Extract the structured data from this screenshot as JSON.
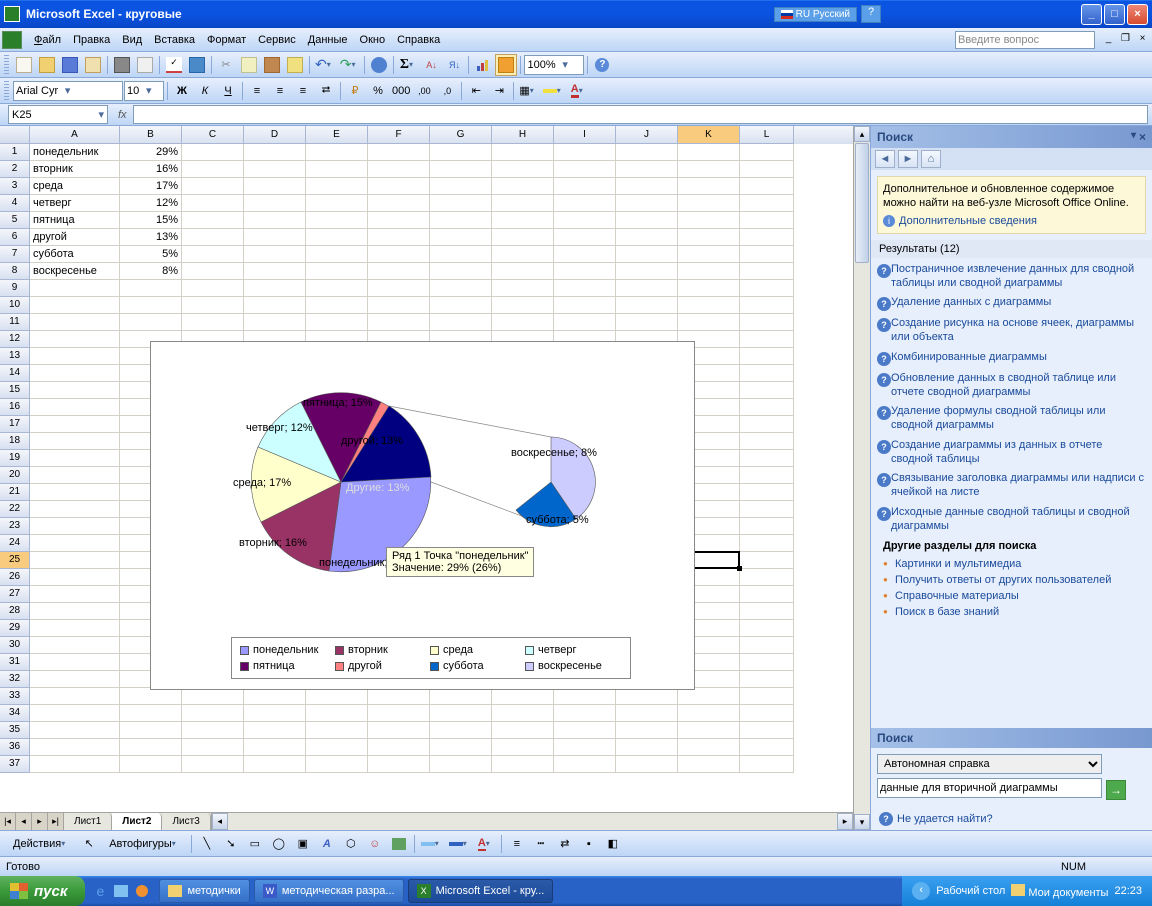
{
  "window": {
    "title": "Microsoft Excel - круговые",
    "lang_label": "RU Русский"
  },
  "menu": {
    "file": "Файл",
    "edit": "Правка",
    "view": "Вид",
    "insert": "Вставка",
    "format": "Формат",
    "tools": "Сервис",
    "data": "Данные",
    "window": "Окно",
    "help": "Справка",
    "help_placeholder": "Введите вопрос"
  },
  "toolbar": {
    "font": "Arial Cyr",
    "size": "10",
    "zoom": "100%"
  },
  "formula_bar": {
    "name_box": "K25",
    "fx": "fx"
  },
  "columns": [
    "A",
    "B",
    "C",
    "D",
    "E",
    "F",
    "G",
    "H",
    "I",
    "J",
    "K",
    "L"
  ],
  "active_col": "K",
  "active_row": "25",
  "grid_data": [
    {
      "a": "понедельник",
      "b": "29%"
    },
    {
      "a": "вторник",
      "b": "16%"
    },
    {
      "a": "среда",
      "b": "17%"
    },
    {
      "a": "четверг",
      "b": "12%"
    },
    {
      "a": "пятница",
      "b": "15%"
    },
    {
      "a": "другой",
      "b": "13%"
    },
    {
      "a": "суббота",
      "b": "5%"
    },
    {
      "a": "воскресенье",
      "b": "8%"
    }
  ],
  "sheets": {
    "s1": "Лист1",
    "s2": "Лист2",
    "s3": "Лист3"
  },
  "chart_data": {
    "type": "pie",
    "secondary_type": "pie_of_pie",
    "categories": [
      "понедельник",
      "вторник",
      "среда",
      "четверг",
      "пятница",
      "другой",
      "суббота",
      "воскресенье"
    ],
    "values": [
      29,
      16,
      17,
      12,
      15,
      13,
      5,
      8
    ],
    "colors": [
      "#9999ff",
      "#993366",
      "#ffffcc",
      "#ccffff",
      "#660066",
      "#ff8080",
      "#0066cc",
      "#ccccff"
    ],
    "labels": {
      "pon": "понедельник;",
      "vt": "вторник; 16%",
      "sr": "среда; 17%",
      "ch": "четверг; 12%",
      "pt": "пятница; 15%",
      "dr": "другой; 13%",
      "dru": "Другие: 13%",
      "sb": "суббота; 5%",
      "vs": "воскресенье; 8%"
    },
    "tooltip_line1": "Ряд 1 Точка \"понедельник\"",
    "tooltip_line2": "Значение: 29% (26%)",
    "legend": [
      "понедельник",
      "вторник",
      "среда",
      "четверг",
      "пятница",
      "другой",
      "суббота",
      "воскресенье"
    ]
  },
  "task_pane": {
    "title": "Поиск",
    "info_text": "Дополнительное и обновленное содержимое можно найти на веб-узле Microsoft Office Online.",
    "info_link": "Дополнительные сведения",
    "results_hdr": "Результаты (12)",
    "results": [
      "Постраничное извлечение данных для сводной таблицы или сводной диаграммы",
      "Удаление данных с диаграммы",
      "Создание рисунка на основе ячеек, диаграммы или объекта",
      "Комбинированные диаграммы",
      "Обновление данных в сводной таблице или отчете сводной диаграммы",
      "Удаление формулы сводной таблицы или сводной диаграммы",
      "Создание диаграммы из данных в отчете сводной таблицы",
      "Связывание заголовка диаграммы или надписи с ячейкой на листе",
      "Исходные данные сводной таблицы и сводной диаграммы"
    ],
    "other_hdr": "Другие разделы для поиска",
    "other": [
      "Картинки и мультимедиа",
      "Получить ответы от других пользователей",
      "Справочные материалы",
      "Поиск в базе знаний"
    ],
    "search_label": "Поиск",
    "search_source": "Автономная справка",
    "search_value": "данные для вторичной диаграммы",
    "cant_find": "Не удается найти?"
  },
  "drawing_toolbar": {
    "actions": "Действия",
    "autoshapes": "Автофигуры"
  },
  "status": {
    "ready": "Готово",
    "num": "NUM"
  },
  "taskbar": {
    "start": "пуск",
    "tasks": [
      {
        "label": "методички",
        "icon": "folder"
      },
      {
        "label": "методическая разра...",
        "icon": "word"
      },
      {
        "label": "Microsoft Excel - кру...",
        "icon": "excel"
      }
    ],
    "desktop": "Рабочий стол",
    "docs": "Мои документы",
    "time": "22:23"
  }
}
